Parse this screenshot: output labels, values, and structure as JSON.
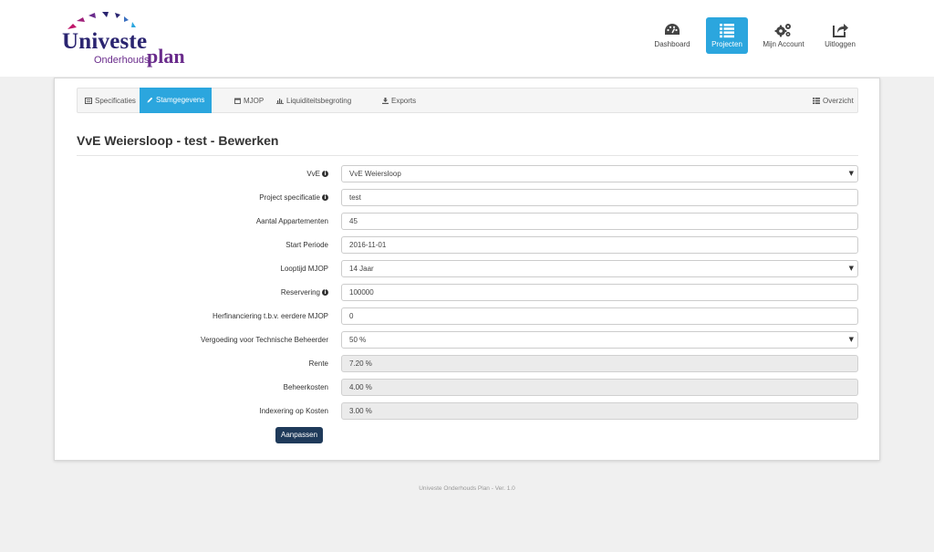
{
  "brand": {
    "word1": "Univeste",
    "word2": "Onderhouds",
    "word3": "plan"
  },
  "nav": [
    {
      "label": "Dashboard",
      "icon": "dashboard-icon",
      "active": false
    },
    {
      "label": "Projecten",
      "icon": "list-icon",
      "active": true
    },
    {
      "label": "Mijn Account",
      "icon": "gears-icon",
      "active": false
    },
    {
      "label": "Uitloggen",
      "icon": "share-icon",
      "active": false
    }
  ],
  "tabs": [
    {
      "label": "Specificaties",
      "icon": "list-alt-icon"
    },
    {
      "label": "Stamgegevens",
      "icon": "pencil-icon",
      "active": true
    },
    {
      "label": "MJOP",
      "icon": "calendar-icon"
    },
    {
      "label": "Liquiditeitsbegroting",
      "icon": "bar-chart-icon"
    },
    {
      "label": "Exports",
      "icon": "download-icon"
    },
    {
      "label": "Overzicht",
      "icon": "th-list-icon"
    }
  ],
  "page_title": "VvE Weiersloop - test - Bewerken",
  "form": {
    "vve": {
      "label": "VvE",
      "value": "VvE Weiersloop"
    },
    "project_spec": {
      "label": "Project specificatie",
      "value": "test"
    },
    "appartementen": {
      "label": "Aantal Appartementen",
      "value": "45"
    },
    "start_periode": {
      "label": "Start Periode",
      "value": "2016-11-01"
    },
    "looptijd": {
      "label": "Looptijd MJOP",
      "value": "14 Jaar"
    },
    "reservering": {
      "label": "Reservering",
      "value": "100000"
    },
    "herfinanciering": {
      "label": "Herfinanciering t.b.v. eerdere MJOP",
      "value": "0"
    },
    "vergoeding": {
      "label": "Vergoeding voor Technische Beheerder",
      "value": "50 %"
    },
    "rente": {
      "label": "Rente",
      "value": "7.20 %"
    },
    "beheerkosten": {
      "label": "Beheerkosten",
      "value": "4.00 %"
    },
    "indexering": {
      "label": "Indexering op Kosten",
      "value": "3.00 %"
    }
  },
  "submit_label": "Aanpassen",
  "footer": "Univeste Onderhouds Plan - Ver. 1.0",
  "colors": {
    "accent": "#2ba6de",
    "submit": "#1f3a5a",
    "brand_dark": "#2a2470",
    "brand_purple": "#6a2c8c"
  }
}
